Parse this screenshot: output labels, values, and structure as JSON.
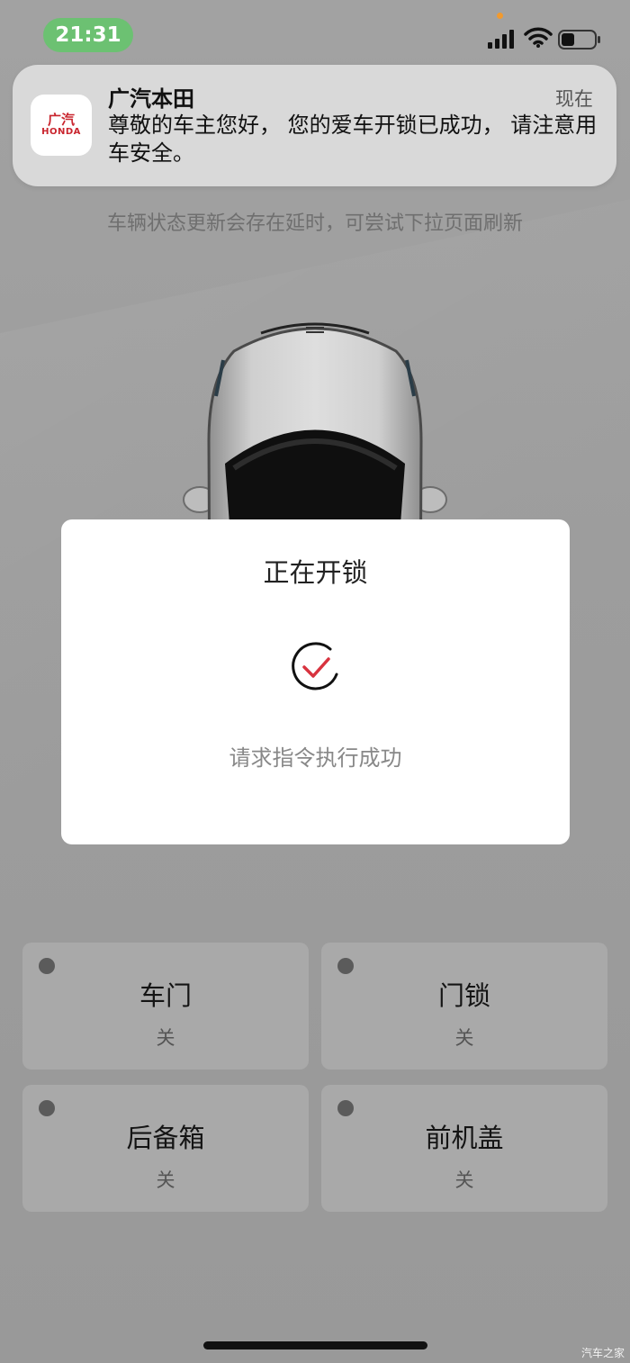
{
  "status_bar": {
    "time": "21:31",
    "signal_icon": "signal-bars-icon",
    "wifi_icon": "wifi-icon",
    "battery_icon": "battery-icon",
    "battery_level": 0.4
  },
  "notification": {
    "app_name": "广汽本田",
    "time": "现在",
    "message": "尊敬的车主您好， 您的爱车开锁已成功， 请注意用车安全。",
    "icon_text_1": "广汽",
    "icon_text_2": "HONDA",
    "icon": "honda-logo-icon"
  },
  "hint": "车辆状态更新会存在延时，可尝试下拉页面刷新",
  "status_tiles": [
    {
      "name": "车门",
      "state": "关"
    },
    {
      "name": "门锁",
      "state": "关"
    },
    {
      "name": "后备箱",
      "state": "关"
    },
    {
      "name": "前机盖",
      "state": "关"
    }
  ],
  "modal": {
    "title": "正在开锁",
    "message": "请求指令执行成功",
    "icon": "success-check-icon"
  },
  "watermark": "汽车之家",
  "colors": {
    "time_pill": "#6cc172",
    "accent_red": "#d8333f",
    "honda_red": "#c9252e"
  }
}
